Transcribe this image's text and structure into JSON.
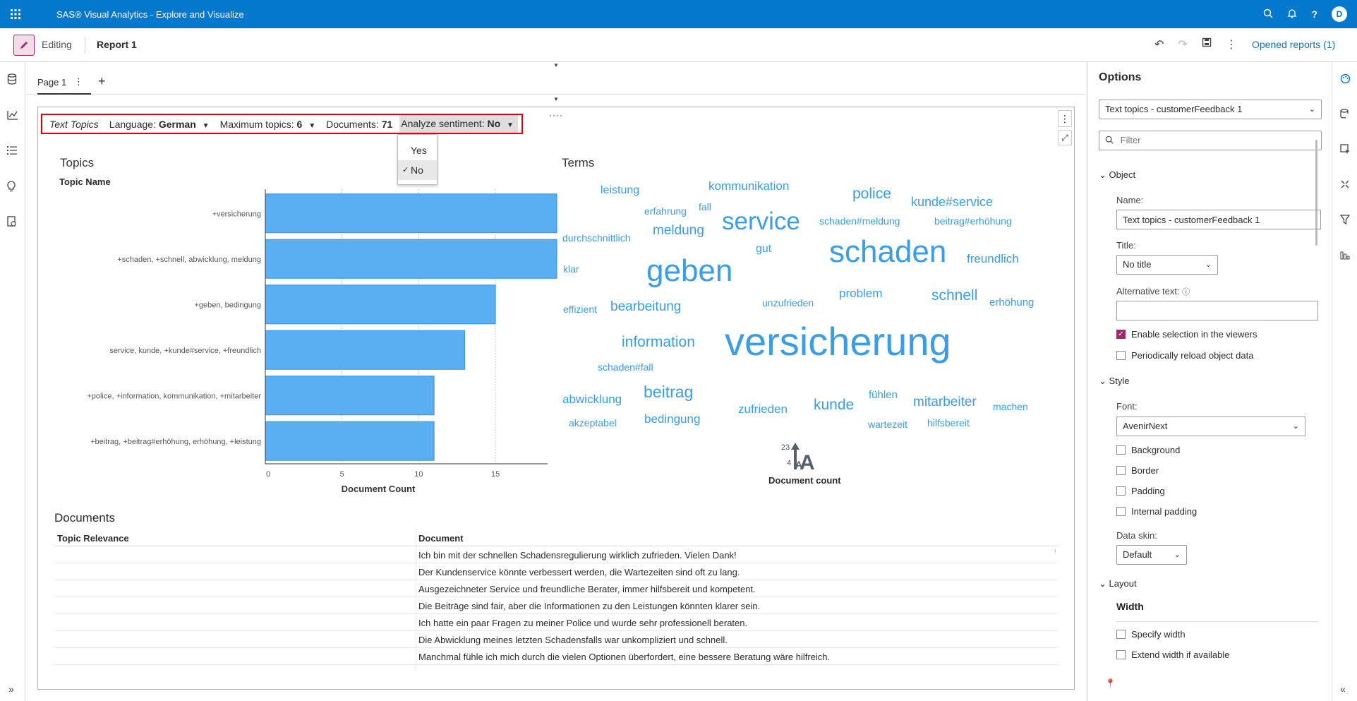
{
  "header": {
    "app_title": "SAS® Visual Analytics - Explore and Visualize",
    "avatar": "D",
    "icons": [
      "search-icon",
      "bell-icon",
      "help-icon"
    ]
  },
  "toolbar": {
    "edit_label": "Editing",
    "report_title": "Report 1",
    "opened_reports": "Opened reports (1)"
  },
  "pages": {
    "tab_label": "Page 1",
    "add": "+"
  },
  "controls": {
    "text_topics": "Text Topics",
    "language_label": "Language:",
    "language_value": "German",
    "max_topics_label": "Maximum topics:",
    "max_topics_value": "6",
    "documents_label": "Documents:",
    "documents_value": "71",
    "sentiment_label": "Analyze sentiment:",
    "sentiment_value": "No",
    "sentiment_options": [
      "Yes",
      "No"
    ]
  },
  "topics": {
    "title": "Topics",
    "column": "Topic Name",
    "xlabel": "Document Count"
  },
  "chart_data": {
    "type": "bar",
    "orientation": "horizontal",
    "title": "Topics",
    "ylabel": "Topic Name",
    "xlabel": "Document Count",
    "categories": [
      "+versicherung",
      "+schaden, +schnell, abwicklung, meldung",
      "+geben, bedingung",
      "service, kunde, +kunde#service, +freundlich",
      "+police, +information, kommunikation, +mitarbeiter",
      "+beitrag, +beitrag#erhöhung, erhöhung, +leistung"
    ],
    "values": [
      19,
      19,
      15,
      13,
      11,
      11
    ],
    "xticks": [
      0,
      5,
      10,
      15
    ],
    "xlim": [
      0,
      18.4
    ],
    "color": "#5aaef2"
  },
  "terms": {
    "title": "Terms",
    "legend_label": "Document count",
    "legend_max": "23",
    "legend_min": "4",
    "color": "#3a9de6",
    "words": [
      {
        "text": "leistung",
        "size": 16
      },
      {
        "text": "kommunikation",
        "size": 17
      },
      {
        "text": "police",
        "size": 21
      },
      {
        "text": "kunde#service",
        "size": 18
      },
      {
        "text": "erfahrung",
        "size": 14
      },
      {
        "text": "fall",
        "size": 14
      },
      {
        "text": "service",
        "size": 35
      },
      {
        "text": "schaden#meldung",
        "size": 14
      },
      {
        "text": "beitrag#erhöhung",
        "size": 14
      },
      {
        "text": "durchschnittlich",
        "size": 14
      },
      {
        "text": "meldung",
        "size": 19
      },
      {
        "text": "gut",
        "size": 16
      },
      {
        "text": "schaden",
        "size": 44
      },
      {
        "text": "freundlich",
        "size": 17
      },
      {
        "text": "klar",
        "size": 14
      },
      {
        "text": "geben",
        "size": 44
      },
      {
        "text": "problem",
        "size": 17
      },
      {
        "text": "schnell",
        "size": 21
      },
      {
        "text": "effizient",
        "size": 14
      },
      {
        "text": "bearbeitung",
        "size": 19
      },
      {
        "text": "unzufrieden",
        "size": 14
      },
      {
        "text": "erhöhung",
        "size": 15
      },
      {
        "text": "information",
        "size": 21
      },
      {
        "text": "versicherung",
        "size": 56
      },
      {
        "text": "schaden#fall",
        "size": 14
      },
      {
        "text": "abwicklung",
        "size": 17
      },
      {
        "text": "beitrag",
        "size": 23
      },
      {
        "text": "fühlen",
        "size": 15
      },
      {
        "text": "mitarbeiter",
        "size": 19
      },
      {
        "text": "zufrieden",
        "size": 17
      },
      {
        "text": "kunde",
        "size": 21
      },
      {
        "text": "machen",
        "size": 14
      },
      {
        "text": "akzeptabel",
        "size": 14
      },
      {
        "text": "bedingung",
        "size": 17
      },
      {
        "text": "wartezeit",
        "size": 14
      },
      {
        "text": "hilfsbereit",
        "size": 14
      }
    ]
  },
  "documents": {
    "title": "Documents",
    "headers": [
      "Topic Relevance",
      "Document"
    ],
    "rows": [
      "Ich bin mit der schnellen Schadensregulierung wirklich zufrieden. Vielen Dank!",
      "Der Kundenservice könnte verbessert werden, die Wartezeiten sind oft zu lang.",
      "Ausgezeichneter Service und freundliche Berater, immer hilfsbereit und kompetent.",
      "Die Beiträge sind fair, aber die Informationen zu den Leistungen könnten klarer sein.",
      "Ich hatte ein paar Fragen zu meiner Police und wurde sehr professionell beraten.",
      "Die Abwicklung meines letzten Schadensfalls war unkompliziert und schnell.",
      "Manchmal fühle ich mich durch die vielen Optionen überfordert, eine bessere Beratung wäre hilfreich."
    ]
  },
  "options": {
    "title": "Options",
    "object_select": "Text topics - customerFeedback 1",
    "filter_placeholder": "Filter",
    "object_section": "Object",
    "name_label": "Name:",
    "name_value": "Text topics - customerFeedback 1",
    "title_label": "Title:",
    "title_value": "No title",
    "alt_label": "Alternative text:",
    "alt_value": "",
    "enable_selection": "Enable selection in the viewers",
    "reload": "Periodically reload object data",
    "style_section": "Style",
    "font_label": "Font:",
    "font_value": "AvenirNext",
    "background": "Background",
    "border": "Border",
    "padding": "Padding",
    "internal_padding": "Internal padding",
    "skin_label": "Data skin:",
    "skin_value": "Default",
    "layout_section": "Layout",
    "width_label": "Width",
    "specify_width": "Specify width",
    "extend_width": "Extend width if available"
  }
}
